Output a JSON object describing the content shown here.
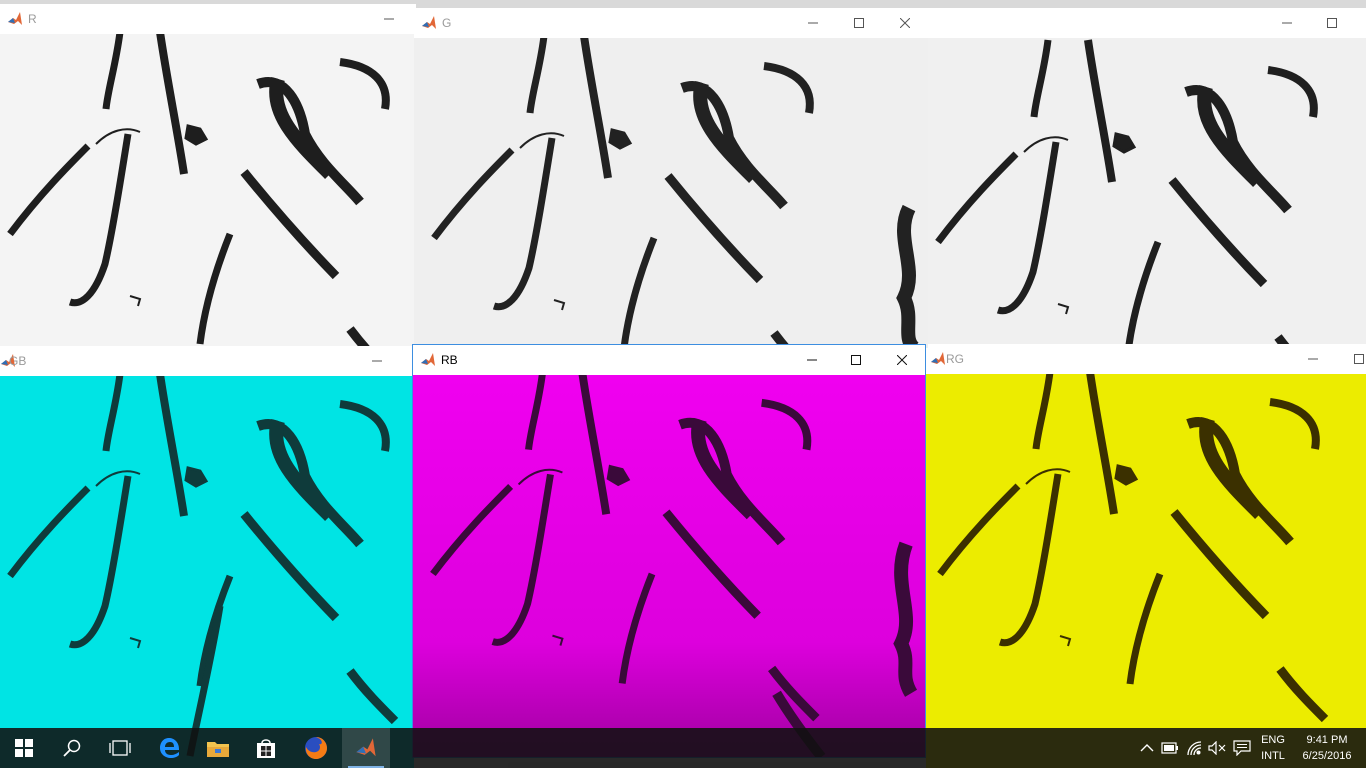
{
  "windows": {
    "r": {
      "title": "R",
      "tint": "#f5f5f5",
      "ink": "#1e1e1e"
    },
    "g": {
      "title": "G",
      "tint": "#f3f3f3",
      "ink": "#222222"
    },
    "b": {
      "title": "",
      "tint": "#f0f0f0",
      "ink": "#1f1f1f"
    },
    "gb": {
      "title": "GB",
      "tint": "#00e6e6",
      "ink": "#0f3b3b"
    },
    "rb": {
      "title": "RB",
      "tint": "#ee00ee",
      "ink": "#3a0a3a"
    },
    "rg": {
      "title": "RG",
      "tint": "#eeee00",
      "ink": "#3b3000"
    }
  },
  "taskbar": {
    "icons": [
      "windows-start-icon",
      "search-icon",
      "task-view-icon",
      "edge-icon",
      "file-explorer-icon",
      "store-icon",
      "firefox-icon",
      "matlab-icon"
    ],
    "active": "matlab-icon",
    "language": "ENG",
    "layout": "INTL",
    "time": "9:41 PM",
    "date": "6/25/2016"
  },
  "colors": {
    "focus_border": "#3d8ee0",
    "taskbar": "#101010",
    "matlab_orange": "#e16737",
    "matlab_blue": "#2f6fb6"
  }
}
